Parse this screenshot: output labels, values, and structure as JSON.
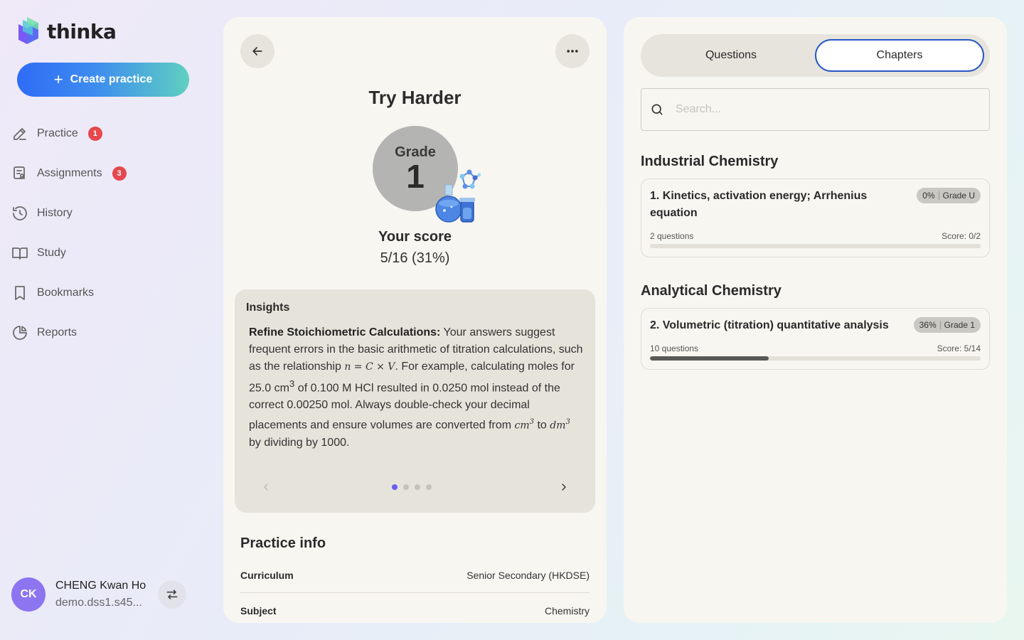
{
  "brand": {
    "name": "thinka"
  },
  "sidebar": {
    "create_label": "Create practice",
    "items": [
      {
        "label": "Practice",
        "badge": "1",
        "icon": "pencil-icon"
      },
      {
        "label": "Assignments",
        "badge": "3",
        "icon": "assignments-icon"
      },
      {
        "label": "History",
        "badge": null,
        "icon": "history-icon"
      },
      {
        "label": "Study",
        "badge": null,
        "icon": "book-icon"
      },
      {
        "label": "Bookmarks",
        "badge": null,
        "icon": "bookmark-icon"
      },
      {
        "label": "Reports",
        "badge": null,
        "icon": "pie-chart-icon"
      }
    ],
    "user": {
      "initials": "CK",
      "name": "CHENG Kwan Ho",
      "email": "demo.dss1.s45..."
    }
  },
  "result": {
    "title": "Try Harder",
    "grade_label": "Grade",
    "grade_value": "1",
    "score_label": "Your score",
    "score_value": "5/16 (31%)"
  },
  "insights": {
    "title": "Insights",
    "heading": "Refine Stoichiometric Calculations:",
    "text_1": " Your answers suggest frequent errors in the basic arithmetic of titration calculations, such as the relationship ",
    "formula_1": "n = C × V",
    "text_2": ". For example, calculating moles for 25.0 cm",
    "sup_1": "3",
    "text_3": " of 0.100 M HCl resulted in 0.0250 mol instead of the correct 0.00250 mol. Always double-check your decimal placements and ensure volumes are converted from ",
    "unit_from": "cm",
    "sup_2": "3",
    "text_4": " to ",
    "unit_to": "dm",
    "sup_3": "3",
    "text_5": " by dividing by 1000.",
    "page_count": 4,
    "active_page": 1
  },
  "practice_info": {
    "title": "Practice info",
    "rows": [
      {
        "key": "Curriculum",
        "value": "Senior Secondary (HKDSE)"
      },
      {
        "key": "Subject",
        "value": "Chemistry"
      }
    ]
  },
  "right": {
    "tabs": [
      {
        "label": "Questions",
        "active": false
      },
      {
        "label": "Chapters",
        "active": true
      }
    ],
    "search_placeholder": "Search...",
    "sections": [
      {
        "title": "Industrial Chemistry",
        "chapter": {
          "name": "1. Kinetics, activation energy; Arrhenius equation",
          "percent": "0%",
          "grade": "Grade U",
          "questions": "2 questions",
          "score": "Score: 0/2",
          "progress": 0
        }
      },
      {
        "title": "Analytical Chemistry",
        "chapter": {
          "name": "2. Volumetric (titration) quantitative analysis",
          "percent": "36%",
          "grade": "Grade 1",
          "questions": "10 questions",
          "score": "Score: 5/14",
          "progress": 0.36
        }
      }
    ]
  },
  "colors": {
    "accent": "#2758c4",
    "badge": "#e5484d",
    "dot_active": "#6a5cf0",
    "avatar": "#8d74f0"
  }
}
